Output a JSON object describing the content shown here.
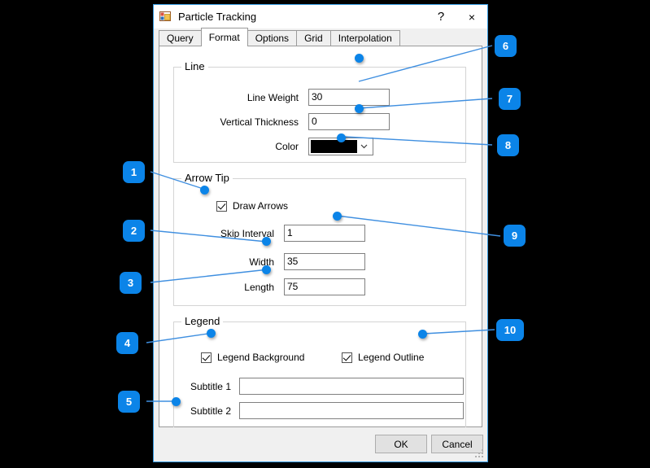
{
  "window": {
    "title": "Particle Tracking",
    "icon": "form-designer-icon",
    "help_label": "?",
    "close_label": "×"
  },
  "tabs": [
    {
      "label": "Query",
      "selected": false
    },
    {
      "label": "Format",
      "selected": true
    },
    {
      "label": "Options",
      "selected": false
    },
    {
      "label": "Grid",
      "selected": false
    },
    {
      "label": "Interpolation",
      "selected": false
    }
  ],
  "groups": {
    "line": {
      "title": "Line",
      "fields": {
        "line_weight": {
          "label": "Line Weight",
          "value": "30"
        },
        "vertical_thickness": {
          "label": "Vertical Thickness",
          "value": "0"
        },
        "color": {
          "label": "Color",
          "value": "#000000",
          "arrow": "⌄"
        }
      }
    },
    "arrow_tip": {
      "title": "Arrow Tip",
      "draw_arrows": {
        "label": "Draw Arrows",
        "checked": true
      },
      "fields": {
        "skip_interval": {
          "label": "Skip Interval",
          "value": "1"
        },
        "width": {
          "label": "Width",
          "value": "35"
        },
        "length": {
          "label": "Length",
          "value": "75"
        }
      }
    },
    "legend": {
      "title": "Legend",
      "legend_background": {
        "label": "Legend Background",
        "checked": true
      },
      "legend_outline": {
        "label": "Legend Outline",
        "checked": true
      },
      "fields": {
        "subtitle_1": {
          "label": "Subtitle 1",
          "value": ""
        },
        "subtitle_2": {
          "label": "Subtitle 2",
          "value": ""
        }
      }
    }
  },
  "footer": {
    "ok_label": "OK",
    "cancel_label": "Cancel"
  },
  "annotations": {
    "accent_color": "#0b84e8",
    "badges": [
      {
        "n": "1",
        "target": "draw-arrows-checkbox"
      },
      {
        "n": "2",
        "target": "width-textbox"
      },
      {
        "n": "3",
        "target": "length-textbox"
      },
      {
        "n": "4",
        "target": "legend-background-checkbox"
      },
      {
        "n": "5",
        "target": "legend-group-bottom"
      },
      {
        "n": "6",
        "target": "line-weight-textbox"
      },
      {
        "n": "7",
        "target": "vertical-thickness-textbox"
      },
      {
        "n": "8",
        "target": "color-combobox"
      },
      {
        "n": "9",
        "target": "skip-interval-textbox"
      },
      {
        "n": "10",
        "target": "legend-outline-checkbox"
      }
    ]
  }
}
